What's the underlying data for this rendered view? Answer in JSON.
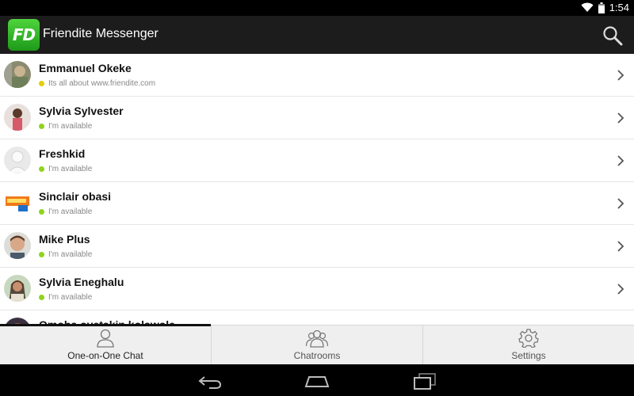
{
  "status_bar": {
    "time": "1:54"
  },
  "app": {
    "title": "Friendite Messenger",
    "logo_text": "FD"
  },
  "contacts": [
    {
      "name": "Emmanuel Okeke",
      "status": "Its all about www.friendite.com",
      "dot_color": "#e0d000"
    },
    {
      "name": "Sylvia Sylvester",
      "status": "I'm available",
      "dot_color": "#8fd41c"
    },
    {
      "name": "Freshkid",
      "status": "I'm available",
      "dot_color": "#8fd41c"
    },
    {
      "name": "Sinclair obasi",
      "status": "I'm available",
      "dot_color": "#8fd41c"
    },
    {
      "name": "Mike Plus",
      "status": "I'm available",
      "dot_color": "#8fd41c"
    },
    {
      "name": "Sylvia Eneghalu",
      "status": "I'm available",
      "dot_color": "#8fd41c"
    },
    {
      "name": "Omoba oyetakin kolawole",
      "status": "",
      "dot_color": "#8fd41c"
    }
  ],
  "tabs": [
    {
      "label": "One-on-One Chat",
      "icon": "person-icon",
      "active": true
    },
    {
      "label": "Chatrooms",
      "icon": "group-icon",
      "active": false
    },
    {
      "label": "Settings",
      "icon": "gear-icon",
      "active": false
    }
  ],
  "colors": {
    "action_bar": "#1c1c1c",
    "accent_green": "#2bb52a",
    "available": "#8fd41c"
  }
}
